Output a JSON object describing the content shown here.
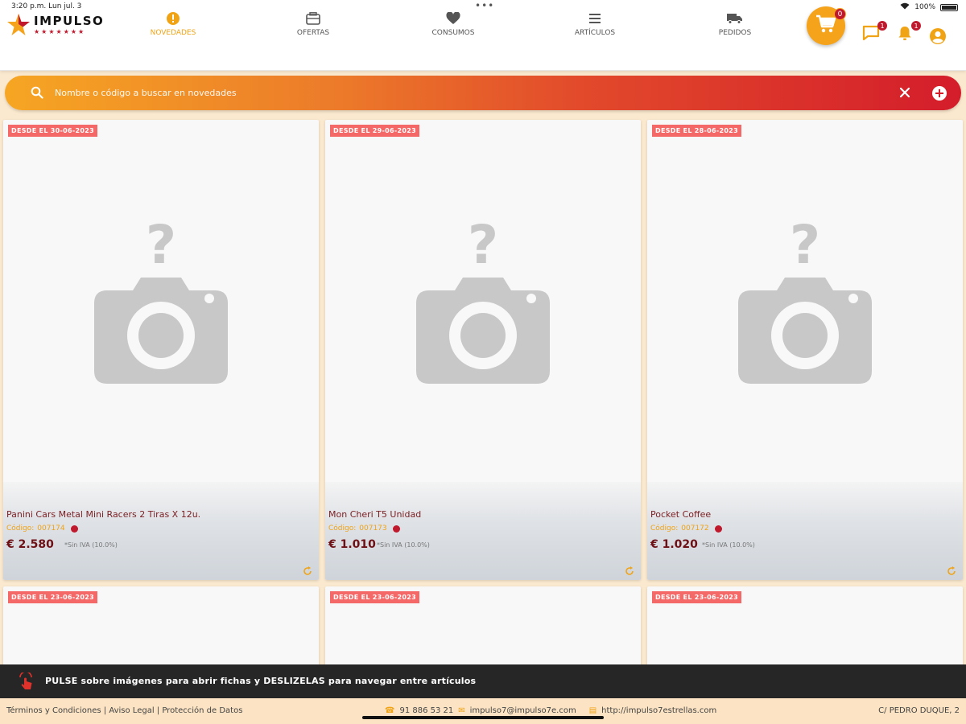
{
  "status": {
    "time": "3:20 p.m.   Lun jul. 3",
    "battery": "100%"
  },
  "brand": {
    "name": "IMPULSO",
    "stars": "★★★★★★★"
  },
  "nav": [
    {
      "label": "NOVEDADES",
      "active": true
    },
    {
      "label": "OFERTAS"
    },
    {
      "label": "CONSUMOS"
    },
    {
      "label": "ARTÍCULOS"
    },
    {
      "label": "PEDIDOS"
    }
  ],
  "cart": {
    "count": "0"
  },
  "notifications": {
    "messages": "1",
    "alerts": "1"
  },
  "search": {
    "placeholder": "Nombre o código a buscar en novedades"
  },
  "products": [
    {
      "badge": "DESDE EL 30-06-2023",
      "name": "Panini Cars Metal Mini Racers 2 Tiras X 12u.",
      "code_label": "Código:",
      "code": "007174",
      "price": "€ 2.580",
      "iva": "*Sin IVA (10.0%)"
    },
    {
      "badge": "DESDE EL 29-06-2023",
      "name": "Mon Cheri T5 Unidad",
      "code_label": "Código:",
      "code": "007173",
      "price": "€ 1.010",
      "iva": "*Sin IVA (10.0%)"
    },
    {
      "badge": "DESDE EL 28-06-2023",
      "name": "Pocket Coffee",
      "code_label": "Código:",
      "code": "007172",
      "price": "€ 1.020",
      "iva": "*Sin IVA (10.0%)"
    }
  ],
  "next_row_badges": [
    "DESDE EL 23-06-2023",
    "DESDE EL 23-06-2023",
    "DESDE EL 23-06-2023"
  ],
  "hint": "PULSE sobre imágenes para abrir fichas y DESLIZELAS para navegar entre artículos",
  "footer": {
    "links": "Términos y Condiciones | Aviso Legal | Protección de Datos",
    "phone": "91 886 53 21",
    "email": "impulso7@impulso7e.com",
    "web": "http://impulso7estrellas.com",
    "address": "C/ PEDRO DUQUE, 2"
  },
  "colors": {
    "accent": "#f0a315",
    "brand_red": "#c0192d",
    "badge": "#f46868"
  }
}
